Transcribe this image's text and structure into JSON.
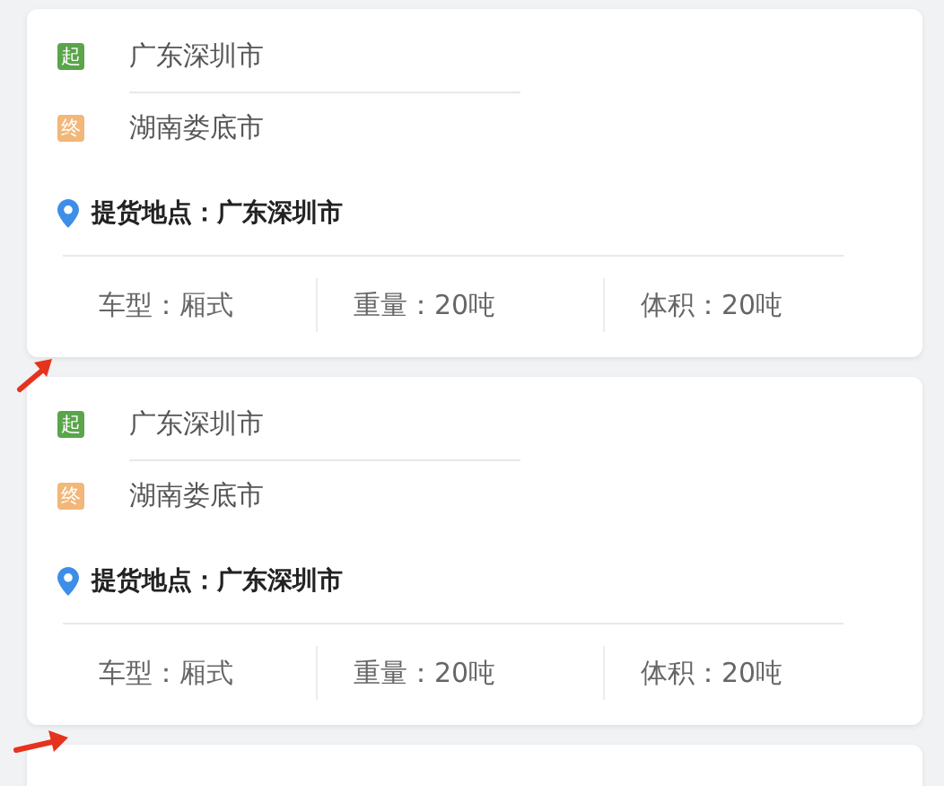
{
  "cards": [
    {
      "annotated": true,
      "stops": [
        {
          "kind": "start",
          "badge": "起",
          "city": "广东深圳市"
        },
        {
          "kind": "end",
          "badge": "终",
          "city": "湖南娄底市"
        }
      ],
      "pickup": {
        "label": "提货地点：",
        "value": "广东深圳市"
      },
      "specs": [
        "车型：厢式",
        "重量：20吨",
        "体积：20吨"
      ]
    },
    {
      "annotated": true,
      "stops": [
        {
          "kind": "start",
          "badge": "起",
          "city": "广东深圳市"
        },
        {
          "kind": "end",
          "badge": "终",
          "city": "湖南娄底市"
        }
      ],
      "pickup": {
        "label": "提货地点：",
        "value": "广东深圳市"
      },
      "specs": [
        "车型：厢式",
        "重量：20吨",
        "体积：20吨"
      ]
    }
  ]
}
